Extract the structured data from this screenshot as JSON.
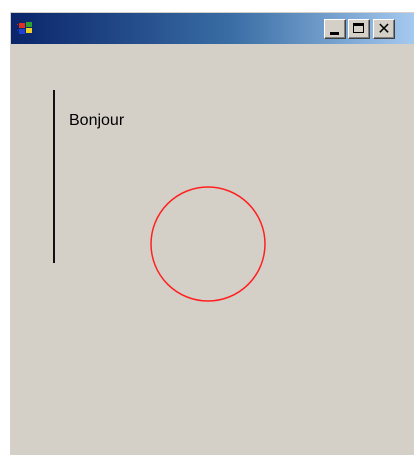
{
  "window": {
    "title_icon": "windows-flag-icon",
    "controls": {
      "minimize": "minimize-icon",
      "maximize": "maximize-icon",
      "close": "close-icon"
    }
  },
  "client": {
    "greeting": "Bonjour",
    "line_color": "#111111",
    "circle_color": "#ff2020",
    "background": "#d4d0c8"
  }
}
